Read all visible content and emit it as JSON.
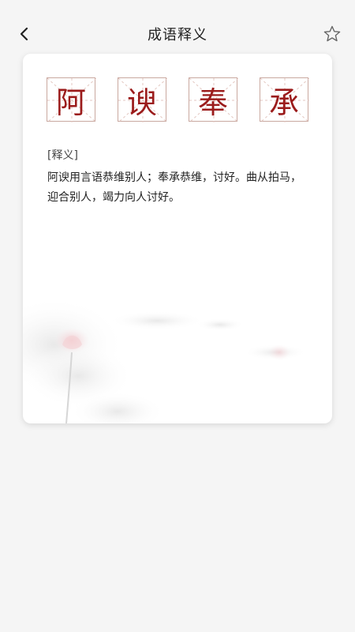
{
  "header": {
    "title": "成语释义"
  },
  "idiom": {
    "characters": [
      "阿",
      "谀",
      "奉",
      "承"
    ]
  },
  "definition": {
    "label": "[释义]",
    "text": "阿谀用言语恭维别人；奉承恭维，讨好。曲从拍马，迎合别人，竭力向人讨好。"
  },
  "colors": {
    "accent": "#9b1b1b",
    "background": "#f5f5f5",
    "card": "#ffffff"
  },
  "icons": {
    "back": "chevron-left-icon",
    "favorite": "star-outline-icon"
  }
}
